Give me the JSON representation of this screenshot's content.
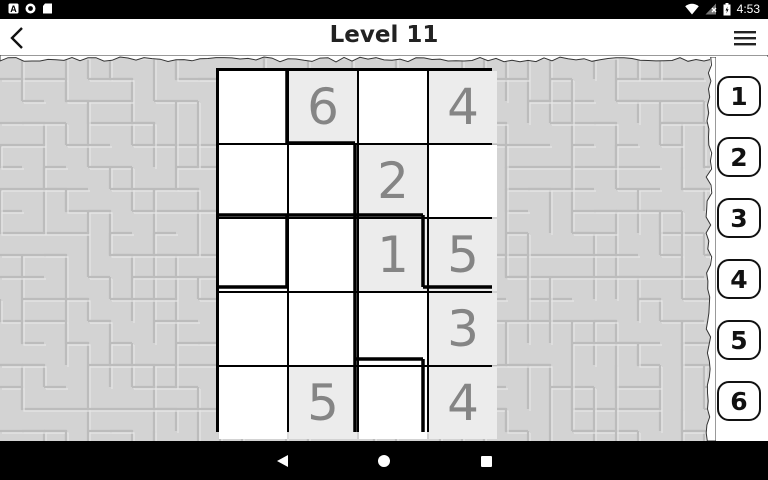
{
  "status_bar": {
    "time": "4:53",
    "left_icons": [
      "app-a-icon",
      "record-icon",
      "sd-card-icon"
    ],
    "right_icons": [
      "wifi-icon",
      "no-sim-icon",
      "battery-icon"
    ]
  },
  "header": {
    "title": "Level 11",
    "back_icon": "back-arrow-icon",
    "menu_icon": "hamburger-menu-icon"
  },
  "puzzle": {
    "rows": 5,
    "cols": 4,
    "cells": [
      [
        {
          "value": "",
          "shaded": false
        },
        {
          "value": "6",
          "shaded": true
        },
        {
          "value": "",
          "shaded": false
        },
        {
          "value": "4",
          "shaded": true
        }
      ],
      [
        {
          "value": "",
          "shaded": false
        },
        {
          "value": "",
          "shaded": false
        },
        {
          "value": "2",
          "shaded": true
        },
        {
          "value": "",
          "shaded": false
        }
      ],
      [
        {
          "value": "",
          "shaded": false
        },
        {
          "value": "",
          "shaded": false
        },
        {
          "value": "1",
          "shaded": true
        },
        {
          "value": "5",
          "shaded": true
        }
      ],
      [
        {
          "value": "",
          "shaded": false
        },
        {
          "value": "",
          "shaded": false
        },
        {
          "value": "",
          "shaded": false
        },
        {
          "value": "3",
          "shaded": true
        }
      ],
      [
        {
          "value": "",
          "shaded": false
        },
        {
          "value": "5",
          "shaded": true
        },
        {
          "value": "",
          "shaded": false
        },
        {
          "value": "4",
          "shaded": true
        }
      ]
    ]
  },
  "number_picker": [
    "1",
    "2",
    "3",
    "4",
    "5",
    "6"
  ],
  "nav_bar": {
    "icons": [
      "nav-back-icon",
      "nav-home-icon",
      "nav-recents-icon"
    ]
  }
}
